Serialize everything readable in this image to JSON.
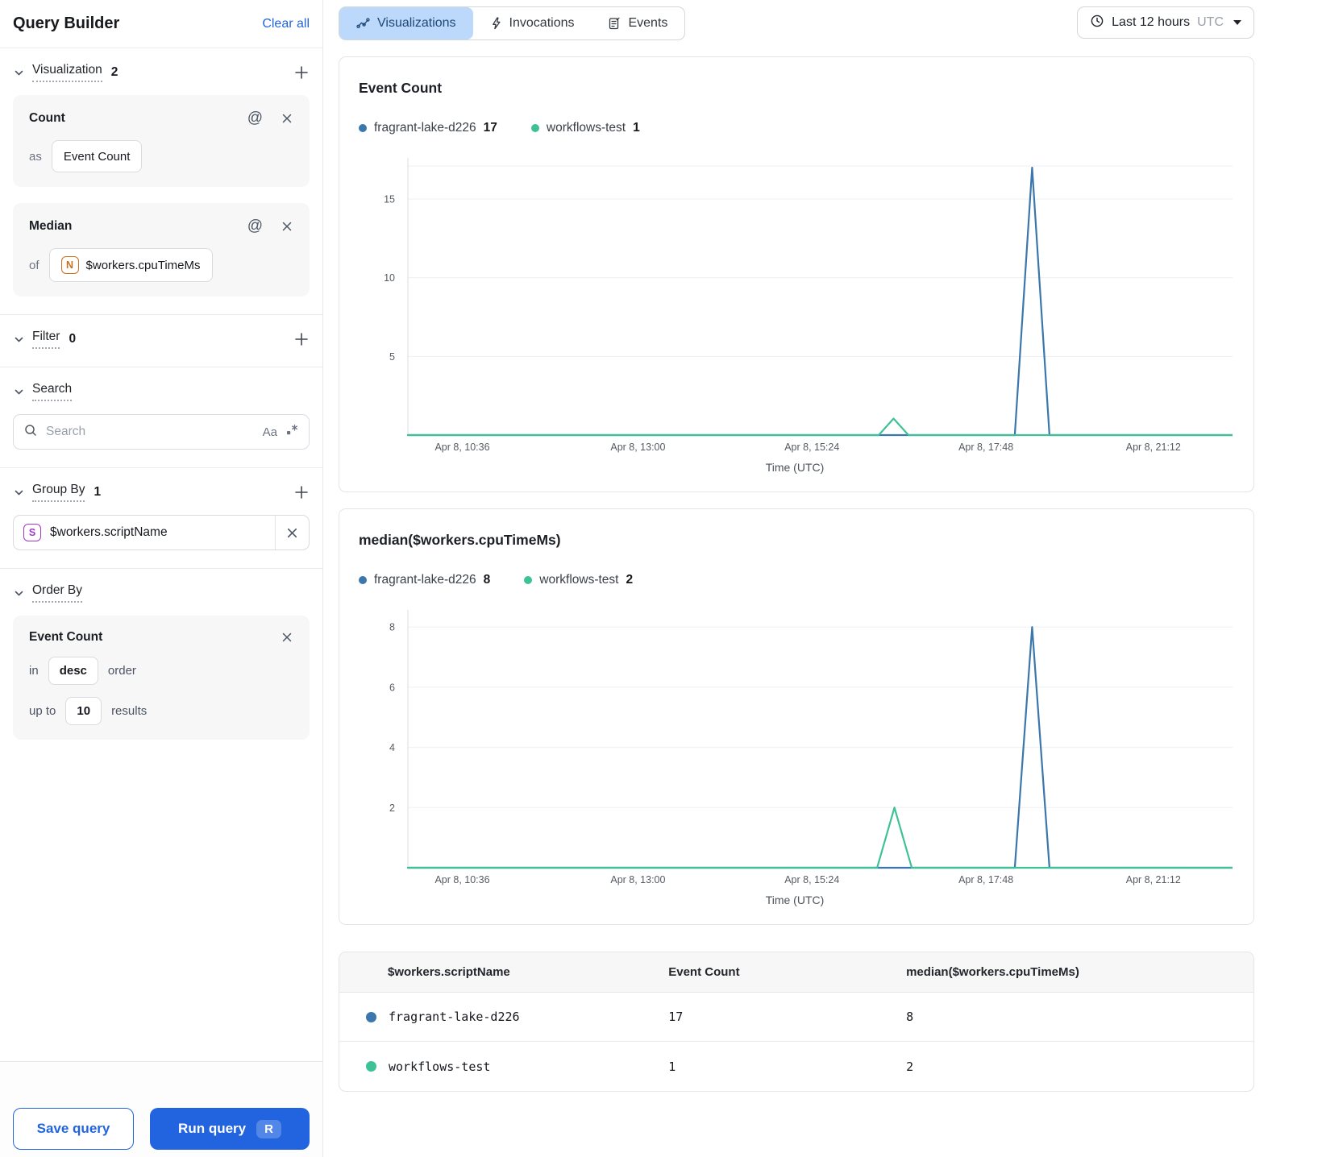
{
  "sidebar": {
    "title": "Query Builder",
    "clear_all_label": "Clear all",
    "visualization_section": {
      "label": "Visualization",
      "count": "2",
      "cards": [
        {
          "title": "Count",
          "prefix": "as",
          "value": "Event Count"
        },
        {
          "title": "Median",
          "prefix": "of",
          "badge_letter": "N",
          "value": "$workers.cpuTimeMs"
        }
      ]
    },
    "filter_section": {
      "label": "Filter",
      "count": "0"
    },
    "search_section": {
      "label": "Search",
      "placeholder": "Search",
      "match_case_label": "Aa"
    },
    "group_by_section": {
      "label": "Group By",
      "count": "1",
      "item": {
        "badge_letter": "S",
        "value": "$workers.scriptName"
      }
    },
    "order_by_section": {
      "label": "Order By",
      "item": {
        "title": "Event Count",
        "in_label": "in",
        "direction": "desc",
        "order_label": "order",
        "up_to_label": "up to",
        "limit": "10",
        "results_label": "results"
      }
    },
    "footer": {
      "save_label": "Save query",
      "run_label": "Run query",
      "run_shortcut": "R"
    }
  },
  "header": {
    "tabs": [
      {
        "label": "Visualizations"
      },
      {
        "label": "Invocations"
      },
      {
        "label": "Events"
      }
    ],
    "time_picker": {
      "range_label": "Last 12 hours",
      "timezone": "UTC"
    }
  },
  "charts": [
    {
      "title": "Event Count",
      "legend": [
        {
          "name": "fragrant-lake-d226",
          "value": "17"
        },
        {
          "name": "workflows-test",
          "value": "1"
        }
      ],
      "chart_data": {
        "type": "line",
        "title": "Event Count",
        "xlabel": "Time (UTC)",
        "ylim": [
          0,
          17.1
        ],
        "y_ticks": [
          5,
          10,
          15
        ],
        "top_gridline": true,
        "x_ticks": [
          {
            "pos": 0.066,
            "label": "Apr 8, 10:36"
          },
          {
            "pos": 0.279,
            "label": "Apr 8, 13:00"
          },
          {
            "pos": 0.49,
            "label": "Apr 8, 15:24"
          },
          {
            "pos": 0.701,
            "label": "Apr 8, 17:48"
          },
          {
            "pos": 0.904,
            "label": "Apr 8, 21:12"
          }
        ],
        "series": [
          {
            "name": "fragrant-lake-d226",
            "color": "#3b76ad",
            "total": 17,
            "points": [
              [
                0,
                0
              ],
              [
                0.736,
                0
              ],
              [
                0.757,
                17
              ],
              [
                0.778,
                0
              ],
              [
                1,
                0
              ]
            ]
          },
          {
            "name": "workflows-test",
            "color": "#3ec197",
            "total": 1,
            "points": [
              [
                0,
                0
              ],
              [
                0.571,
                0
              ],
              [
                0.589,
                1.05
              ],
              [
                0.607,
                0
              ],
              [
                1,
                0
              ]
            ]
          }
        ]
      }
    },
    {
      "title": "median($workers.cpuTimeMs)",
      "legend": [
        {
          "name": "fragrant-lake-d226",
          "value": "8"
        },
        {
          "name": "workflows-test",
          "value": "2"
        }
      ],
      "chart_data": {
        "type": "line",
        "title": "median($workers.cpuTimeMs)",
        "xlabel": "Time (UTC)",
        "ylim": [
          0,
          8.3
        ],
        "y_ticks": [
          2,
          4,
          6,
          8
        ],
        "top_gridline": false,
        "x_ticks": [
          {
            "pos": 0.066,
            "label": "Apr 8, 10:36"
          },
          {
            "pos": 0.279,
            "label": "Apr 8, 13:00"
          },
          {
            "pos": 0.49,
            "label": "Apr 8, 15:24"
          },
          {
            "pos": 0.701,
            "label": "Apr 8, 17:48"
          },
          {
            "pos": 0.904,
            "label": "Apr 8, 21:12"
          }
        ],
        "series": [
          {
            "name": "fragrant-lake-d226",
            "color": "#3b76ad",
            "total": 8,
            "points": [
              [
                0,
                0
              ],
              [
                0.736,
                0
              ],
              [
                0.757,
                8
              ],
              [
                0.778,
                0
              ],
              [
                1,
                0
              ]
            ]
          },
          {
            "name": "workflows-test",
            "color": "#3ec197",
            "total": 2,
            "points": [
              [
                0,
                0
              ],
              [
                0.569,
                0
              ],
              [
                0.59,
                2
              ],
              [
                0.611,
                0
              ],
              [
                1,
                0
              ]
            ]
          }
        ]
      }
    }
  ],
  "table": {
    "columns": [
      "$workers.scriptName",
      "Event Count",
      "median($workers.cpuTimeMs)"
    ],
    "rows": [
      {
        "color": "#3b76ad",
        "name": "fragrant-lake-d226",
        "event_count": "17",
        "median": "8"
      },
      {
        "color": "#3ec197",
        "name": "workflows-test",
        "event_count": "1",
        "median": "2"
      }
    ]
  },
  "colors": {
    "accent_blue": "#2264e0",
    "tab_selected_bg": "#bcd8fb",
    "series_blue": "#3b76ad",
    "series_green": "#3ec197"
  }
}
